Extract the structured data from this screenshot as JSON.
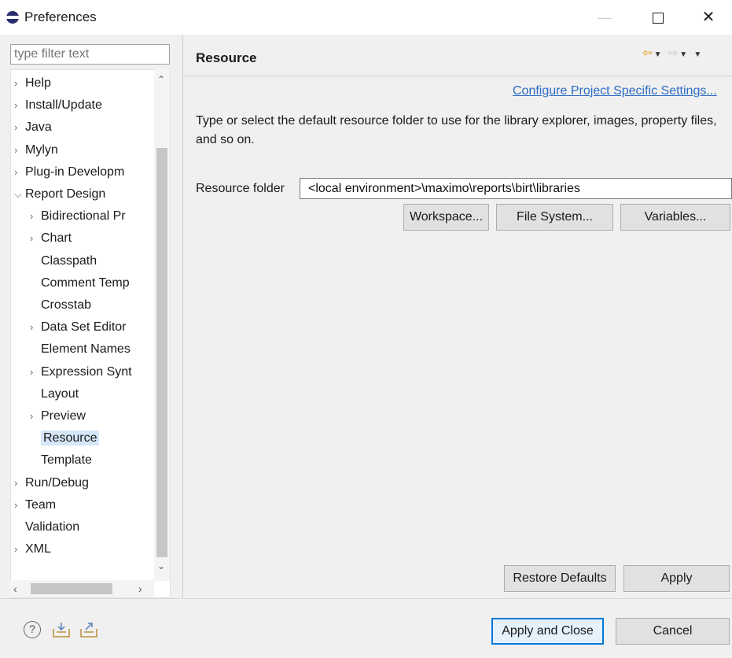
{
  "window": {
    "title": "Preferences"
  },
  "filter": {
    "placeholder": "type filter text"
  },
  "tree": [
    {
      "label": "Help",
      "expander": ">",
      "indent": 0
    },
    {
      "label": "Install/Update",
      "expander": ">",
      "indent": 0
    },
    {
      "label": "Java",
      "expander": ">",
      "indent": 0
    },
    {
      "label": "Mylyn",
      "expander": ">",
      "indent": 0
    },
    {
      "label": "Plug-in Developm",
      "expander": ">",
      "indent": 0
    },
    {
      "label": "Report Design",
      "expander": "v",
      "indent": 0
    },
    {
      "label": "Bidirectional Pr",
      "expander": ">",
      "indent": 1
    },
    {
      "label": "Chart",
      "expander": ">",
      "indent": 1
    },
    {
      "label": "Classpath",
      "expander": "",
      "indent": 1
    },
    {
      "label": "Comment Temp",
      "expander": "",
      "indent": 1
    },
    {
      "label": "Crosstab",
      "expander": "",
      "indent": 1
    },
    {
      "label": "Data Set Editor",
      "expander": ">",
      "indent": 1
    },
    {
      "label": "Element Names",
      "expander": "",
      "indent": 1
    },
    {
      "label": "Expression Synt",
      "expander": ">",
      "indent": 1
    },
    {
      "label": "Layout",
      "expander": "",
      "indent": 1
    },
    {
      "label": "Preview",
      "expander": ">",
      "indent": 1
    },
    {
      "label": "Resource",
      "expander": "",
      "indent": 1,
      "selected": true
    },
    {
      "label": "Template",
      "expander": "",
      "indent": 1
    },
    {
      "label": "Run/Debug",
      "expander": ">",
      "indent": 0
    },
    {
      "label": "Team",
      "expander": ">",
      "indent": 0
    },
    {
      "label": "Validation",
      "expander": "",
      "indent": 0
    },
    {
      "label": "XML",
      "expander": ">",
      "indent": 0
    }
  ],
  "page": {
    "title": "Resource",
    "config_link": "Configure Project Specific Settings...",
    "description": "Type or select the default resource folder to use for the library explorer, images, property files, and so on.",
    "resource_label": "Resource folder",
    "resource_value": "<local environment>\\maximo\\reports\\birt\\libraries",
    "workspace_btn": "Workspace...",
    "filesystem_btn": "File System...",
    "variables_btn": "Variables...",
    "restore_btn": "Restore Defaults",
    "apply_btn": "Apply"
  },
  "footer": {
    "apply_close_btn": "Apply and Close",
    "cancel_btn": "Cancel"
  },
  "icons": {
    "app": "eclipse-icon",
    "help": "help-icon",
    "import": "import-icon",
    "export": "export-icon",
    "back": "back-arrow-icon",
    "forward": "forward-arrow-icon"
  },
  "colors": {
    "link": "#2b6cc4",
    "selection": "#d4e6f8",
    "primary_border": "#0078d7",
    "nav_arrow": "#e0a010"
  }
}
